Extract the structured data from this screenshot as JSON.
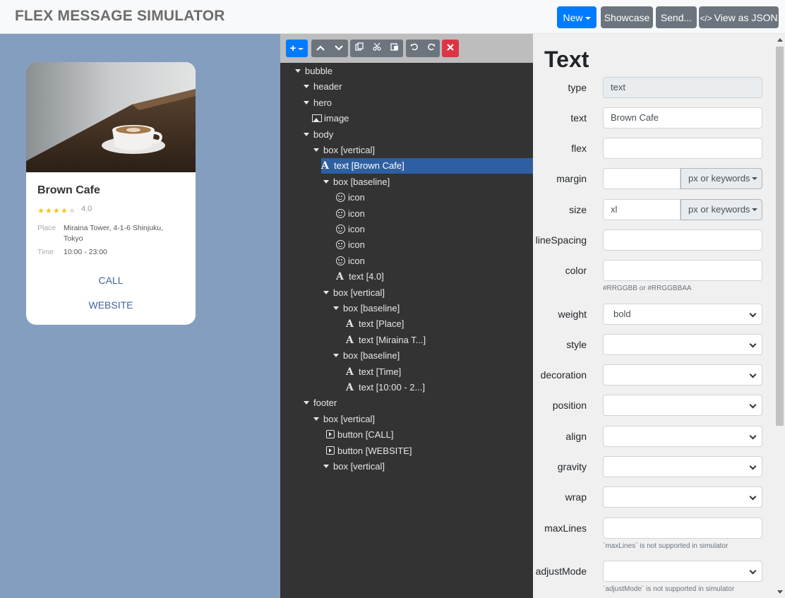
{
  "header": {
    "brand": "FLEX MESSAGE SIMULATOR",
    "buttons": {
      "new": "New",
      "showcase": "Showcase",
      "send": "Send...",
      "json": "View as JSON",
      "json_icon": "</>"
    }
  },
  "preview": {
    "title": "Brown Cafe",
    "rating": "4.0",
    "stars_filled": 4,
    "stars_total": 5,
    "place_label": "Place",
    "place_value": "Miraina Tower, 4-1-6 Shinjuku, Tokyo",
    "time_label": "Time",
    "time_value": "10:00 - 23:00",
    "call": "CALL",
    "website": "WEBSITE",
    "colors": {
      "background": "#849ebf",
      "star": "#f5c518",
      "star_empty": "#dcdcdc",
      "link": "#42659a"
    }
  },
  "toolbar": {
    "icons": [
      "plus-icon",
      "arrow-up-icon",
      "arrow-down-icon",
      "copy-icon",
      "cut-icon",
      "paste-icon",
      "undo-icon",
      "redo-icon",
      "delete-icon"
    ]
  },
  "tree": [
    {
      "label": "bubble",
      "depth": 0,
      "icon": "tri"
    },
    {
      "label": "header",
      "depth": 1,
      "icon": "tri"
    },
    {
      "label": "hero",
      "depth": 1,
      "icon": "tri"
    },
    {
      "label": "image",
      "depth": 2,
      "icon": "img"
    },
    {
      "label": "body",
      "depth": 1,
      "icon": "tri"
    },
    {
      "label": "box [vertical]",
      "depth": 2,
      "icon": "tri"
    },
    {
      "label": "text [Brown Cafe]",
      "depth": 3,
      "icon": "A",
      "selected": true
    },
    {
      "label": "box [baseline]",
      "depth": 3,
      "icon": "tri"
    },
    {
      "label": "icon",
      "depth": 4,
      "icon": "smile"
    },
    {
      "label": "icon",
      "depth": 4,
      "icon": "smile"
    },
    {
      "label": "icon",
      "depth": 4,
      "icon": "smile"
    },
    {
      "label": "icon",
      "depth": 4,
      "icon": "smile"
    },
    {
      "label": "icon",
      "depth": 4,
      "icon": "smile"
    },
    {
      "label": "text [4.0]",
      "depth": 4,
      "icon": "A"
    },
    {
      "label": "box [vertical]",
      "depth": 3,
      "icon": "tri"
    },
    {
      "label": "box [baseline]",
      "depth": 4,
      "icon": "tri"
    },
    {
      "label": "text [Place]",
      "depth": 5,
      "icon": "A"
    },
    {
      "label": "text [Miraina T...]",
      "depth": 5,
      "icon": "A"
    },
    {
      "label": "box [baseline]",
      "depth": 4,
      "icon": "tri"
    },
    {
      "label": "text [Time]",
      "depth": 5,
      "icon": "A"
    },
    {
      "label": "text [10:00 - 2...]",
      "depth": 5,
      "icon": "A"
    },
    {
      "label": "footer",
      "depth": 1,
      "icon": "tri"
    },
    {
      "label": "box [vertical]",
      "depth": 2,
      "icon": "tri"
    },
    {
      "label": "button [CALL]",
      "depth": 3,
      "icon": "play"
    },
    {
      "label": "button [WEBSITE]",
      "depth": 3,
      "icon": "play"
    },
    {
      "label": "box [vertical]",
      "depth": 3,
      "icon": "tri"
    }
  ],
  "props": {
    "title": "Text",
    "fields": [
      {
        "key": "type",
        "label": "type",
        "kind": "readonly",
        "value": "text"
      },
      {
        "key": "text",
        "label": "text",
        "kind": "input",
        "value": "Brown Cafe"
      },
      {
        "key": "flex",
        "label": "flex",
        "kind": "input",
        "value": ""
      },
      {
        "key": "margin",
        "label": "margin",
        "kind": "unit",
        "value": "",
        "unit": "px or keywords"
      },
      {
        "key": "size",
        "label": "size",
        "kind": "unit",
        "value": "xl",
        "unit": "px or keywords"
      },
      {
        "key": "lineSpacing",
        "label": "lineSpacing",
        "kind": "input",
        "value": ""
      },
      {
        "key": "color",
        "label": "color",
        "kind": "input",
        "value": "",
        "help": "#RRGGBB or #RRGGBBAA"
      },
      {
        "key": "weight",
        "label": "weight",
        "kind": "select",
        "value": "bold"
      },
      {
        "key": "style",
        "label": "style",
        "kind": "select",
        "value": ""
      },
      {
        "key": "decoration",
        "label": "decoration",
        "kind": "select",
        "value": ""
      },
      {
        "key": "position",
        "label": "position",
        "kind": "select",
        "value": ""
      },
      {
        "key": "align",
        "label": "align",
        "kind": "select",
        "value": ""
      },
      {
        "key": "gravity",
        "label": "gravity",
        "kind": "select",
        "value": ""
      },
      {
        "key": "wrap",
        "label": "wrap",
        "kind": "select",
        "value": ""
      },
      {
        "key": "maxLines",
        "label": "maxLines",
        "kind": "input",
        "value": "",
        "help": "`maxLines` is not supported in simulator"
      },
      {
        "key": "adjustMode",
        "label": "adjustMode",
        "kind": "select",
        "value": "",
        "help": "`adjustMode` is not supported in simulator"
      }
    ]
  }
}
